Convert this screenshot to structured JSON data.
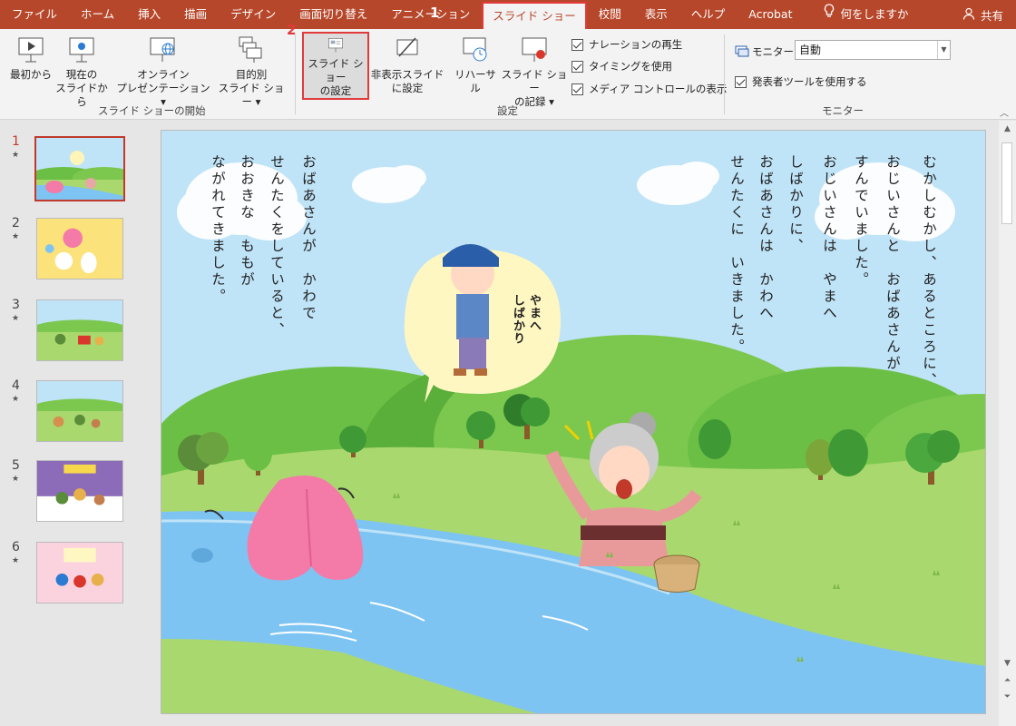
{
  "tabs": [
    "ファイル",
    "ホーム",
    "挿入",
    "描画",
    "デザイン",
    "画面切り替え",
    "アニメーション",
    "スライド ショー",
    "校閲",
    "表示",
    "ヘルプ",
    "Acrobat"
  ],
  "active_tab": "スライド ショー",
  "tell_me": "何をしますか",
  "share": "共有",
  "callouts": {
    "one": "1",
    "two": "2"
  },
  "ribbon": {
    "start": {
      "from_beginning": "最初から",
      "from_current_1": "現在の",
      "from_current_2": "スライドから",
      "online_1": "オンライン",
      "online_2": "プレゼンテーション ▾",
      "custom_1": "目的別",
      "custom_2": "スライド ショー ▾",
      "label": "スライド ショーの開始"
    },
    "setup": {
      "setup_1": "スライド ショー",
      "setup_2": "の設定",
      "hide_1": "非表示スライド",
      "hide_2": "に設定",
      "rehearse": "リハーサル",
      "record_1": "スライド ショー",
      "record_2": "の記録 ▾",
      "play_narration": "ナレーションの再生",
      "use_timings": "タイミングを使用",
      "show_media": "メディア コントロールの表示",
      "label": "設定"
    },
    "monitors": {
      "monitor_label": "モニター:",
      "monitor_value": "自動",
      "presenter_view": "発表者ツールを使用する",
      "label": "モニター"
    }
  },
  "slide_numbers": [
    "1",
    "2",
    "3",
    "4",
    "5",
    "6"
  ],
  "slide_text": {
    "col1": "むかしむかし、あるところに、",
    "col2": "おじいさんと　おばあさんが",
    "col3": "すんでいました。",
    "col4": "おじいさんは　やまへ",
    "col5": "しばかりに、",
    "col6": "おばあさんは　かわへ",
    "col7": "せんたくに　いきました。",
    "col8": "おばあさんが　かわで",
    "col9": "せんたくをしていると、",
    "col10": "おおきな　ももが",
    "col11": "ながれてきました。",
    "bubble": "やまへ\nしばかり"
  },
  "colors": {
    "accent": "#b7472a",
    "highlight": "#e23a3a",
    "sky": "#bfe3f7",
    "grass": "#a9d86e",
    "river": "#7ec4f2",
    "peach": "#f47aa8"
  }
}
